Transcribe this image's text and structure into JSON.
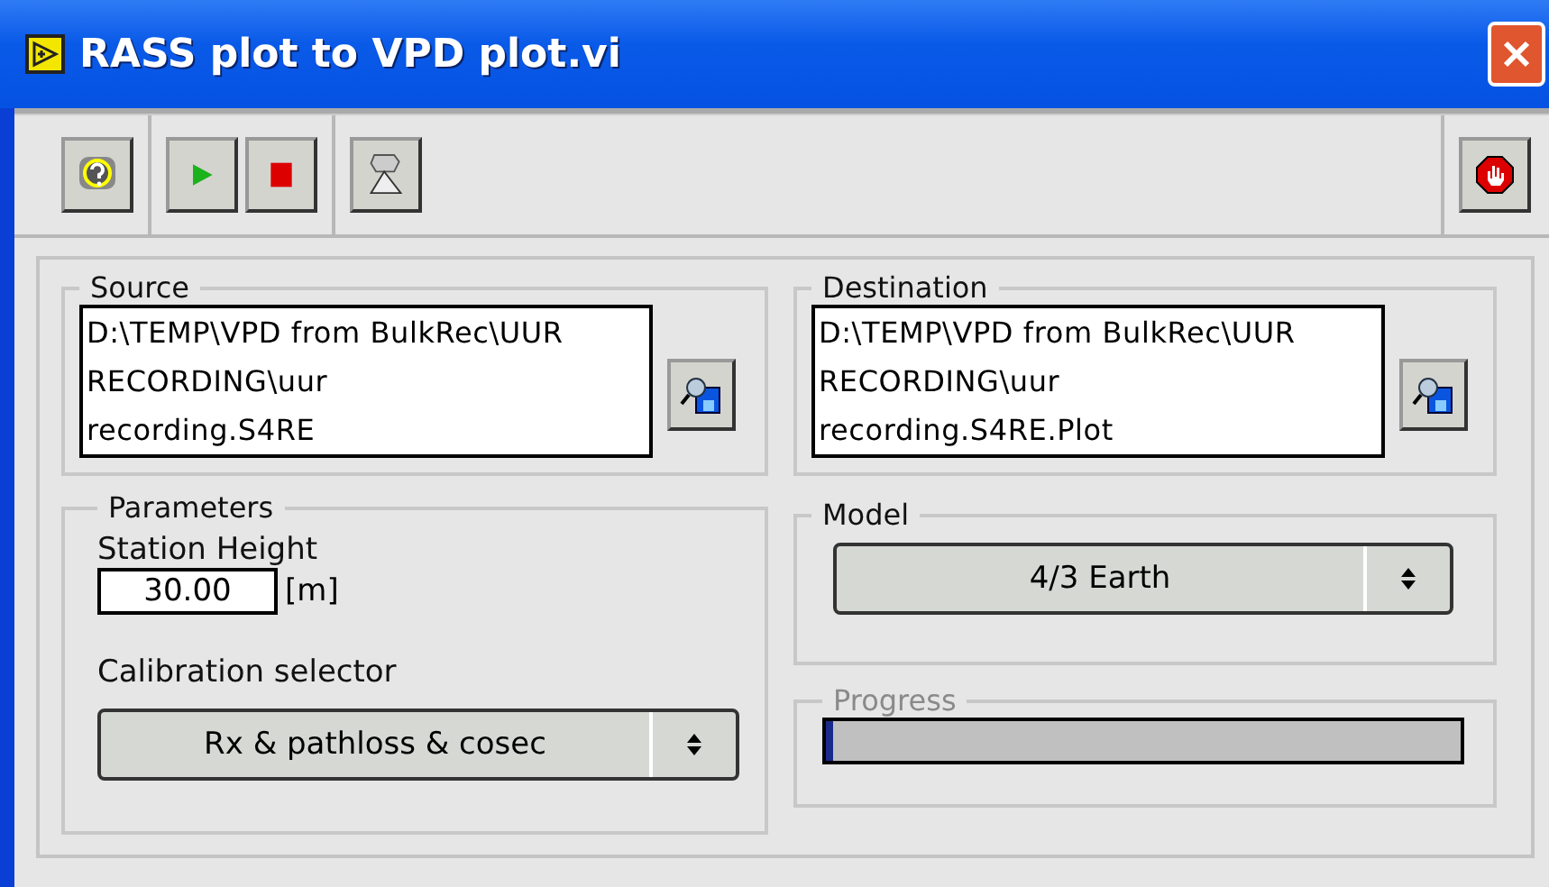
{
  "window": {
    "title": "RASS plot to VPD plot.vi"
  },
  "toolbar": [
    {
      "kind": "help"
    },
    {
      "kind": "run"
    },
    {
      "kind": "abort"
    },
    {
      "kind": "highlight"
    }
  ],
  "stop_button": {
    "kind": "stop"
  },
  "source": {
    "label": "Source",
    "lines": [
      "D:\\TEMP\\VPD from BulkRec\\UUR",
      "RECORDING\\uur",
      "recording.S4RE"
    ]
  },
  "destination": {
    "label": "Destination",
    "lines": [
      "D:\\TEMP\\VPD from BulkRec\\UUR",
      "RECORDING\\uur",
      "recording.S4RE.Plot"
    ]
  },
  "parameters": {
    "label": "Parameters",
    "station_height": {
      "label": "Station Height",
      "value": "30.00",
      "unit": "[m]"
    },
    "calibration": {
      "label": "Calibration selector",
      "value": "Rx & pathloss & cosec"
    }
  },
  "model": {
    "label": "Model",
    "value": "4/3 Earth"
  },
  "progress": {
    "label": "Progress",
    "disabled": true,
    "level": 0.01
  }
}
